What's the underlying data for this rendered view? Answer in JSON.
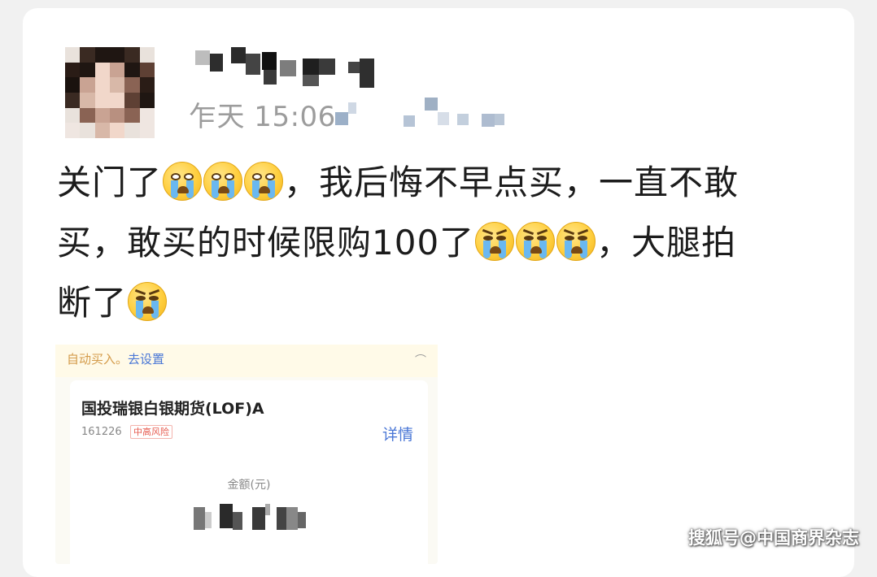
{
  "post": {
    "timestamp": "乍天 15:06",
    "line1_text_a": "关门了",
    "line1_text_b": "，我后悔不早点买，一直不敢",
    "line2_text_a": "买，敢买的时候限购100了",
    "line2_text_b": "，大腿拍",
    "line3_text": "断了"
  },
  "screenshot": {
    "autobuy_text": "自动买入。",
    "autobuy_link": "去设置",
    "corner_glyph": "⌒",
    "fund_name": "国投瑞银白银期货(LOF)A",
    "fund_code": "161226",
    "risk_label": "中高风险",
    "details_label": "详情",
    "amount_label": "金额(元)"
  },
  "watermark": "搜狐号@中国商界杂志",
  "icons": {
    "emoji_cry": "crying-face-emoji",
    "emoji_angry_cry": "angry-crying-face-emoji"
  },
  "colors": {
    "link_blue": "#4a77d6",
    "risk_red": "#e65a4e",
    "timestamp_gray": "#9c9c9c"
  }
}
